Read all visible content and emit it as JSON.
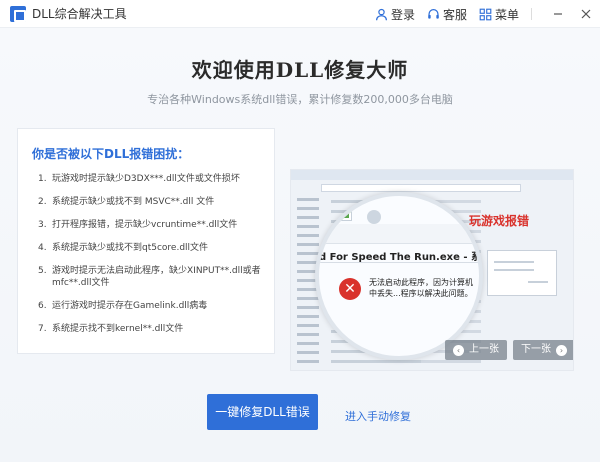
{
  "app": {
    "title": "DLL综合解决工具",
    "login_label": "登录",
    "service_label": "客服",
    "menu_label": "菜单"
  },
  "hero": {
    "title": "欢迎使用DLL修复大师",
    "subtitle": "专治各种Windows系统dll错误，累计修复数200,000多台电脑"
  },
  "issues": {
    "title": "你是否被以下DLL报错困扰：",
    "items": [
      {
        "num": "1.",
        "text": "玩游戏时提示缺少D3DX***.dll文件或文件损坏"
      },
      {
        "num": "2.",
        "text": "系统提示缺少或找不到 MSVC**.dll 文件"
      },
      {
        "num": "3.",
        "text": "打开程序报错，提示缺少vcruntime**.dll文件"
      },
      {
        "num": "4.",
        "text": "系统提示缺少或找不到qt5core.dll文件"
      },
      {
        "num": "5.",
        "text": "游戏时提示无法启动此程序，缺少XINPUT**.dll或者mfc**.dll文件"
      },
      {
        "num": "6.",
        "text": "运行游戏时提示存在Gamelink.dll病毒"
      },
      {
        "num": "7.",
        "text": "系统提示找不到kernel**.dll文件"
      }
    ]
  },
  "preview": {
    "tag": "玩游戏报错",
    "window_title": "d For Speed The Run.exe - 系统错误",
    "error_message": "无法启动此程序，因为计算机中丢失...程序以解决此问题。",
    "prev_label": "上一张",
    "next_label": "下一张"
  },
  "actions": {
    "fix_label": "一键修复DLL错误",
    "manual_label": "进入手动修复"
  },
  "watermark": "",
  "colors": {
    "accent": "#2f6fd8",
    "error": "#d9322c"
  }
}
